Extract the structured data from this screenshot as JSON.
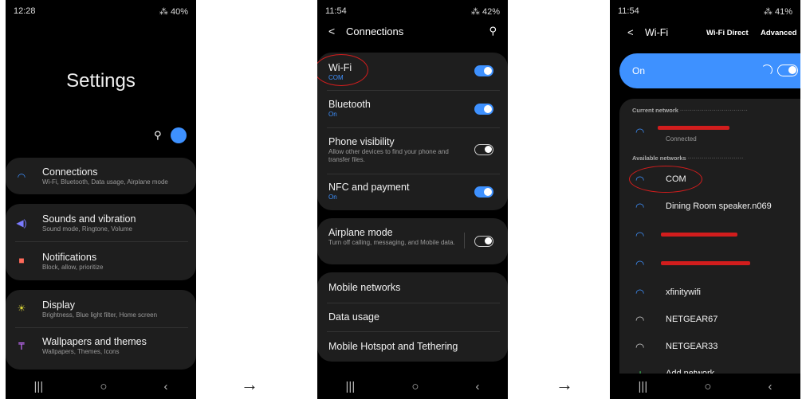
{
  "colors": {
    "accent": "#3e91ff",
    "card": "#1e1e1e",
    "annotation": "#d21d1d"
  },
  "screen1": {
    "status": {
      "time": "12:28",
      "battery": "40%"
    },
    "title": "Settings",
    "items": [
      {
        "label": "Connections",
        "sub": "Wi-Fi, Bluetooth, Data usage, Airplane mode",
        "icon": "wifi-icon"
      },
      {
        "label": "Sounds and vibration",
        "sub": "Sound mode, Ringtone, Volume",
        "icon": "speaker-icon"
      },
      {
        "label": "Notifications",
        "sub": "Block, allow, prioritize",
        "icon": "notification-icon"
      },
      {
        "label": "Display",
        "sub": "Brightness, Blue light filter, Home screen",
        "icon": "sun-icon"
      },
      {
        "label": "Wallpapers and themes",
        "sub": "Wallpapers, Themes, Icons",
        "icon": "brush-icon"
      }
    ]
  },
  "screen2": {
    "status": {
      "time": "11:54",
      "battery": "42%"
    },
    "header": "Connections",
    "items": [
      {
        "label": "Wi-Fi",
        "sub": "COM"
      },
      {
        "label": "Bluetooth",
        "sub": "On"
      },
      {
        "label": "Phone visibility",
        "sub": "Allow other devices to find your phone and transfer files."
      },
      {
        "label": "NFC and payment",
        "sub": "On"
      },
      {
        "label": "Airplane mode",
        "sub": "Turn off calling, messaging, and Mobile data."
      },
      {
        "label": "Mobile networks"
      },
      {
        "label": "Data usage"
      },
      {
        "label": "Mobile Hotspot and Tethering"
      }
    ],
    "toggles": {
      "wifi": true,
      "bluetooth": true,
      "visibility": false,
      "nfc": true,
      "airplane": false
    }
  },
  "screen3": {
    "status": {
      "time": "11:54",
      "battery": "41%"
    },
    "header": "Wi-Fi",
    "wifi_direct": "Wi-Fi Direct",
    "advanced": "Advanced",
    "on_label": "On",
    "current_network": "Current network",
    "connected": "Connected",
    "available_networks": "Available networks",
    "networks": [
      "COM",
      "Dining Room speaker.n069",
      "xfinitywifi",
      "NETGEAR67",
      "NETGEAR33"
    ],
    "add_network": "Add network"
  },
  "arrow": "→"
}
